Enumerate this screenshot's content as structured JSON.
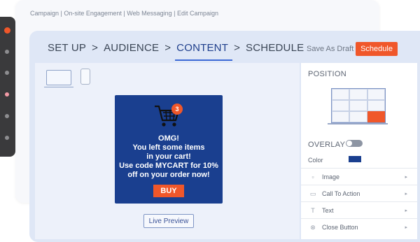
{
  "breadcrumb": "Campaign | On-site Engagement | Web Messaging | Edit Campaign",
  "steps": {
    "step1": "SET UP",
    "step2": "AUDIENCE",
    "step3": "CONTENT",
    "step4": "SCHEDULE",
    "separator": ">"
  },
  "header_actions": {
    "save_draft": "Save As Draft",
    "schedule": "Schedule"
  },
  "popup": {
    "badge_count": "3",
    "message": "OMG!\nYou left some items\nin your cart!\nUse code MYCART for 10%\noff on your order now!",
    "buy_label": "BUY"
  },
  "live_preview": "Live Preview",
  "side_panel": {
    "position_label": "POSITION",
    "selected_position": "bottom-right",
    "overlay_label": "OVERLAY",
    "color_label": "Color",
    "color_value": "#1a3f8f",
    "items": [
      {
        "label": "Image",
        "icon": "image-icon"
      },
      {
        "label": "Call To Action",
        "icon": "button-icon"
      },
      {
        "label": "Text",
        "icon": "text-icon"
      },
      {
        "label": "Close Button",
        "icon": "close-circle-icon"
      }
    ]
  },
  "colors": {
    "accent": "#f0572a",
    "popup_bg": "#1a3f8f",
    "active_step": "#1f3f8c"
  }
}
